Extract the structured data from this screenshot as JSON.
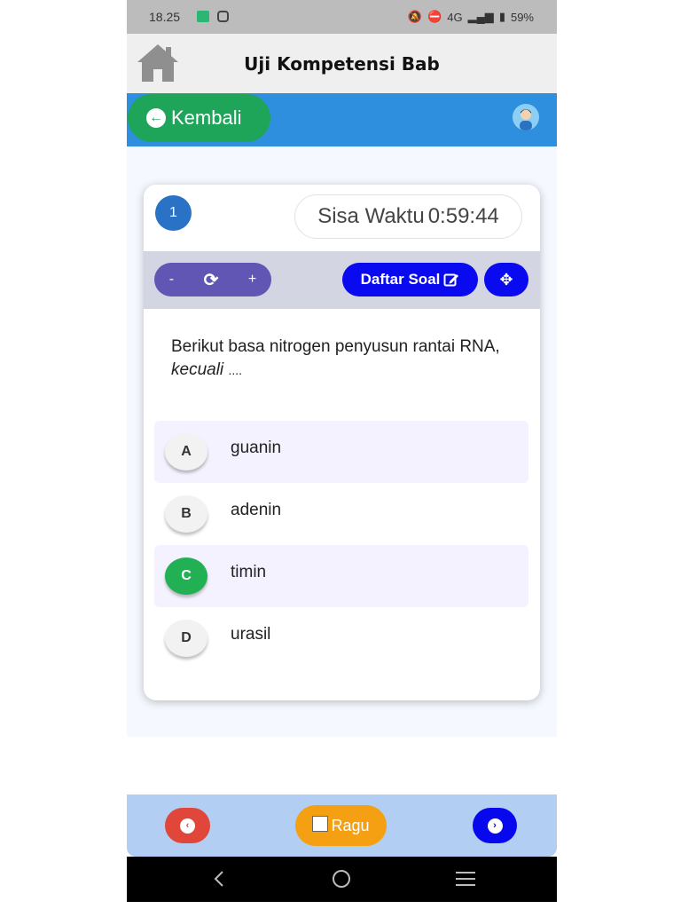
{
  "status_bar": {
    "time": "18.25",
    "signal_text": "4G",
    "battery": "59%"
  },
  "header": {
    "title": "Uji Kompetensi Bab"
  },
  "top_bar": {
    "back_label": "Kembali"
  },
  "quiz": {
    "question_number": "1",
    "timer_label": "Sisa Waktu",
    "timer_value": "0:59:44",
    "zoom_minus": "-",
    "zoom_plus": "+",
    "daftar_soal_label": "Daftar Soal",
    "question_text": "Berikut basa nitrogen penyusun rantai RNA,",
    "question_emphasis": "kecuali",
    "question_suffix": "....",
    "options": [
      {
        "letter": "A",
        "text": "guanin"
      },
      {
        "letter": "B",
        "text": "adenin"
      },
      {
        "letter": "C",
        "text": "timin"
      },
      {
        "letter": "D",
        "text": "urasil"
      }
    ],
    "selected_option": "C"
  },
  "bottom_bar": {
    "ragu_label": "Ragu"
  },
  "colors": {
    "accent_blue": "#2f8fdf",
    "back_green": "#1fa55a",
    "selected_green": "#22b055",
    "ragu_orange": "#f5a012",
    "prev_red": "#e1463b",
    "next_blue": "#0808ee"
  }
}
